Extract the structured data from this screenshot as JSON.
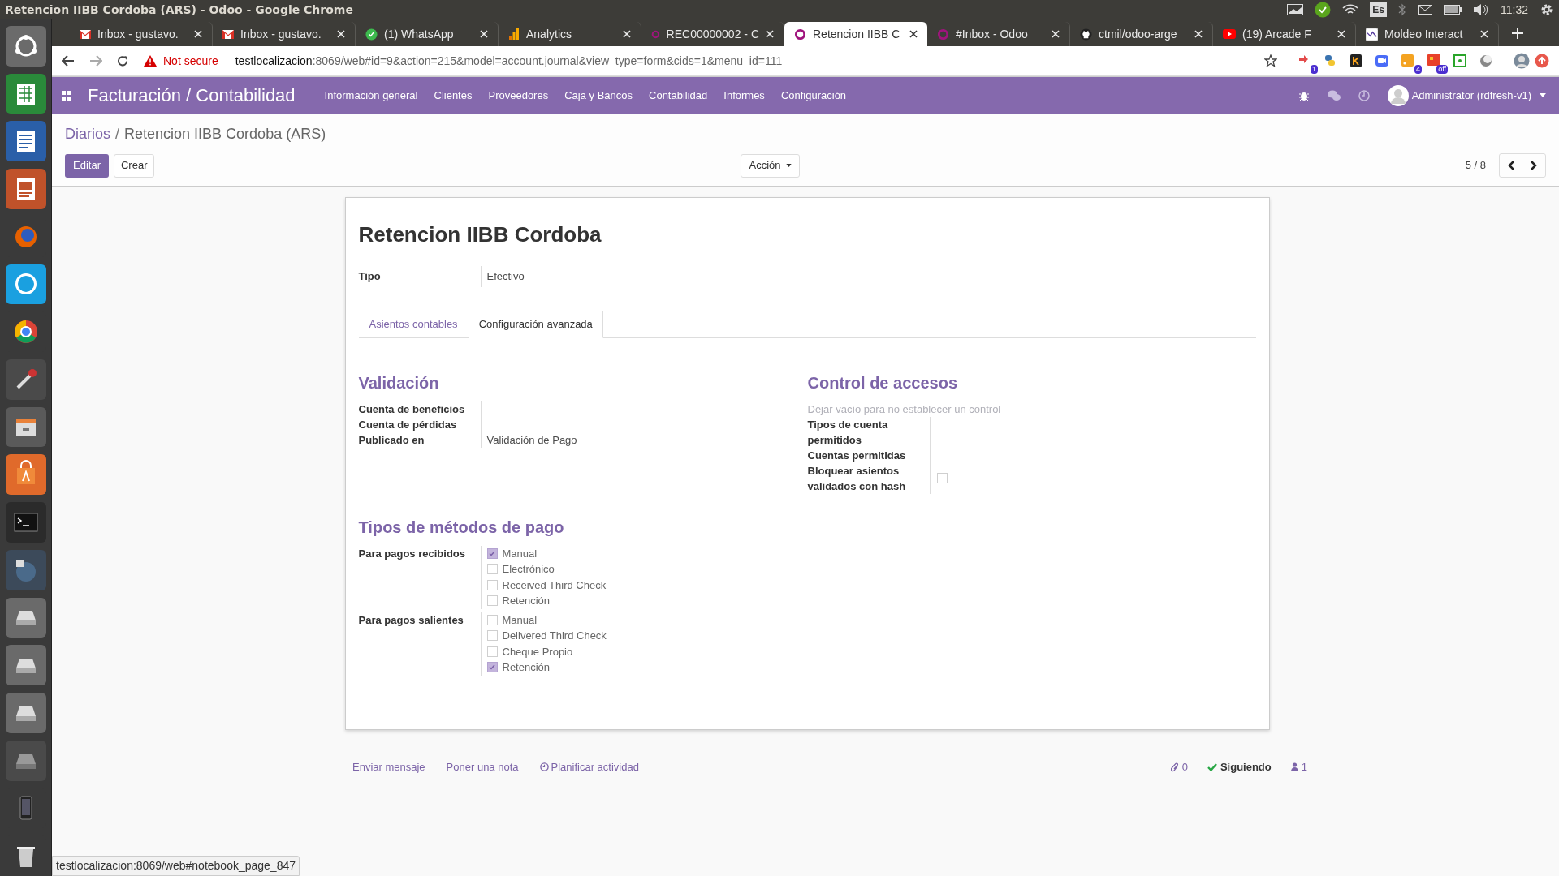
{
  "system_bar": {
    "title": "Retencion IIBB Cordoba (ARS) - Odoo - Google Chrome",
    "keyboard": "Es",
    "time": "11:32"
  },
  "browser": {
    "tabs": [
      {
        "label": "Inbox - gustavo.",
        "kind": "mail",
        "selected": false
      },
      {
        "label": "Inbox - gustavo.",
        "kind": "mail",
        "selected": false
      },
      {
        "label": "(1) WhatsApp",
        "kind": "chat",
        "selected": false
      },
      {
        "label": "Analytics",
        "kind": "chart",
        "selected": false
      },
      {
        "label": "REC00000002 - C",
        "kind": "ring",
        "selected": false
      },
      {
        "label": "Retencion IIBB C",
        "kind": "ring",
        "selected": true
      },
      {
        "label": "#Inbox - Odoo",
        "kind": "ring",
        "selected": false
      },
      {
        "label": "ctmil/odoo-arge",
        "kind": "cat",
        "selected": false
      },
      {
        "label": "(19) Arcade F",
        "kind": "video",
        "selected": false
      },
      {
        "label": "Moldeo Interact",
        "kind": "wave",
        "selected": false
      }
    ],
    "warning": "Not secure",
    "host": "testlocalizacion",
    "path": ":8069/web#id=9&action=215&model=account.journal&view_type=form&cids=1&menu_id=111",
    "extensions": [
      {
        "kind": "arrows",
        "badge": "1"
      },
      {
        "kind": "snake"
      },
      {
        "kind": "k"
      },
      {
        "kind": "camera"
      },
      {
        "kind": "feed",
        "badge": "4"
      },
      {
        "kind": "grid",
        "badge": "off"
      },
      {
        "kind": "question"
      },
      {
        "kind": "moon"
      }
    ]
  },
  "navbar": {
    "app_title": "Facturación / Contabilidad",
    "menu": [
      "Información general",
      "Clientes",
      "Proveedores",
      "Caja y Bancos",
      "Contabilidad",
      "Informes",
      "Configuración"
    ],
    "user": "Administrator (rdfresh-v1)"
  },
  "breadcrumb": {
    "parent": "Diarios",
    "separator": "/",
    "current": "Retencion IIBB Cordoba (ARS)"
  },
  "controls": {
    "edit": "Editar",
    "create": "Crear",
    "action": "Acción",
    "pager": "5 / 8"
  },
  "form": {
    "title": "Retencion IIBB Cordoba",
    "fields": [
      {
        "label": "Tipo",
        "value": "Efectivo"
      }
    ],
    "tabs": [
      {
        "label": "Asientos contables",
        "selected": false
      },
      {
        "label": "Configuración avanzada",
        "selected": true
      }
    ],
    "validation": {
      "title": "Validación",
      "fields": [
        {
          "label": "Cuenta de beneficios"
        },
        {
          "label": "Cuenta de pérdidas"
        },
        {
          "label": "Publicado en",
          "value": "Validación de Pago"
        }
      ]
    },
    "access": {
      "title": "Control de accesos",
      "hint": "Dejar vacío para no establecer un control",
      "fields": [
        {
          "label": "Tipos de cuenta permitidos",
          "kind": "text"
        },
        {
          "label": "Cuentas permitidas",
          "kind": "text"
        },
        {
          "label": "Bloquear asientos validados con hash",
          "kind": "checkbox",
          "checked": false
        }
      ]
    },
    "payment": {
      "title": "Tipos de métodos de pago",
      "groups": [
        {
          "label": "Para pagos recibidos",
          "options": [
            {
              "label": "Manual",
              "checked": true
            },
            {
              "label": "Electrónico",
              "checked": false
            },
            {
              "label": "Received Third Check",
              "checked": false
            },
            {
              "label": "Retención",
              "checked": false
            }
          ]
        },
        {
          "label": "Para pagos salientes",
          "options": [
            {
              "label": "Manual",
              "checked": false
            },
            {
              "label": "Delivered Third Check",
              "checked": false
            },
            {
              "label": "Cheque Propio",
              "checked": false
            },
            {
              "label": "Retención",
              "checked": true
            }
          ]
        }
      ]
    }
  },
  "chatter": {
    "actions": [
      "Enviar mensaje",
      "Poner una nota",
      "Planificar actividad"
    ],
    "attachments": "0",
    "following": "Siguiendo",
    "followers": "1"
  },
  "status_url": "testlocalizacion:8069/web#notebook_page_847"
}
